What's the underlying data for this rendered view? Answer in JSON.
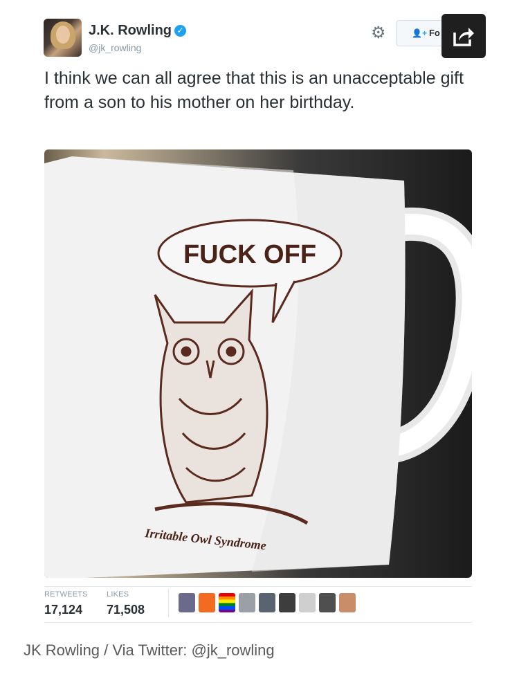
{
  "author": {
    "name": "J.K. Rowling",
    "handle": "@jk_rowling",
    "verified_badge": "✓"
  },
  "actions": {
    "settings_icon": "gear-icon",
    "follow_label": "Fo",
    "share_icon": "share-icon"
  },
  "tweet": {
    "text": "I think we can all agree that this is an unacceptable gift from a son to his mother on her birthday."
  },
  "image": {
    "speech_bubble": "FUCK OFF",
    "mug_caption": "Irritable Owl Syndrome"
  },
  "stats": {
    "retweets_label": "RETWEETS",
    "retweets_value": "17,124",
    "likes_label": "LIKES",
    "likes_value": "71,508"
  },
  "liker_avatars": [
    "#6a6a8a",
    "#f26b21",
    "rainbow",
    "#9aa0a6",
    "#5a6470",
    "#3d3d3d",
    "#cfcfcf",
    "#4f4f4f",
    "#c98d6a"
  ],
  "caption": "JK Rowling / Via Twitter: @jk_rowling"
}
